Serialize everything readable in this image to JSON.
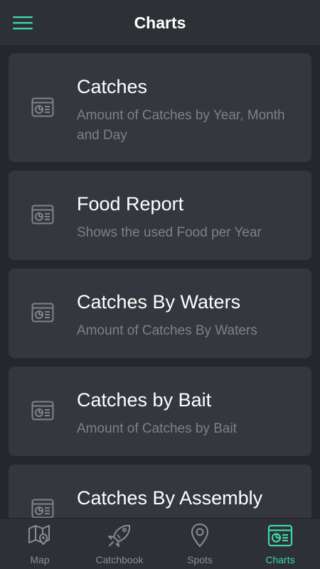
{
  "header": {
    "title": "Charts",
    "menu_icon": "hamburger-menu-icon",
    "accent_color": "#3fd6a6"
  },
  "charts": [
    {
      "title": "Catches",
      "subtitle": "Amount of Catches by Year, Month and Day",
      "icon": "chart-list-icon"
    },
    {
      "title": "Food Report",
      "subtitle": "Shows the used Food per Year",
      "icon": "chart-list-icon"
    },
    {
      "title": "Catches By Waters",
      "subtitle": "Amount of Catches By Waters",
      "icon": "chart-list-icon"
    },
    {
      "title": "Catches by Bait",
      "subtitle": "Amount of Catches by Bait",
      "icon": "chart-list-icon"
    },
    {
      "title": "Catches By Assembly",
      "subtitle": "",
      "icon": "chart-list-icon"
    }
  ],
  "tabs": [
    {
      "label": "Map",
      "icon": "map-icon",
      "active": false
    },
    {
      "label": "Catchbook",
      "icon": "fish-icon",
      "active": false
    },
    {
      "label": "Spots",
      "icon": "location-pin-icon",
      "active": false
    },
    {
      "label": "Charts",
      "icon": "chart-list-icon",
      "active": true
    }
  ],
  "colors": {
    "background": "#24272b",
    "card": "#34373d",
    "bars": "#2d3035",
    "title_text": "#ffffff",
    "subtitle_text": "#7d8188",
    "inactive_tab": "#8a8e94",
    "active_tab": "#3fd6a6"
  }
}
